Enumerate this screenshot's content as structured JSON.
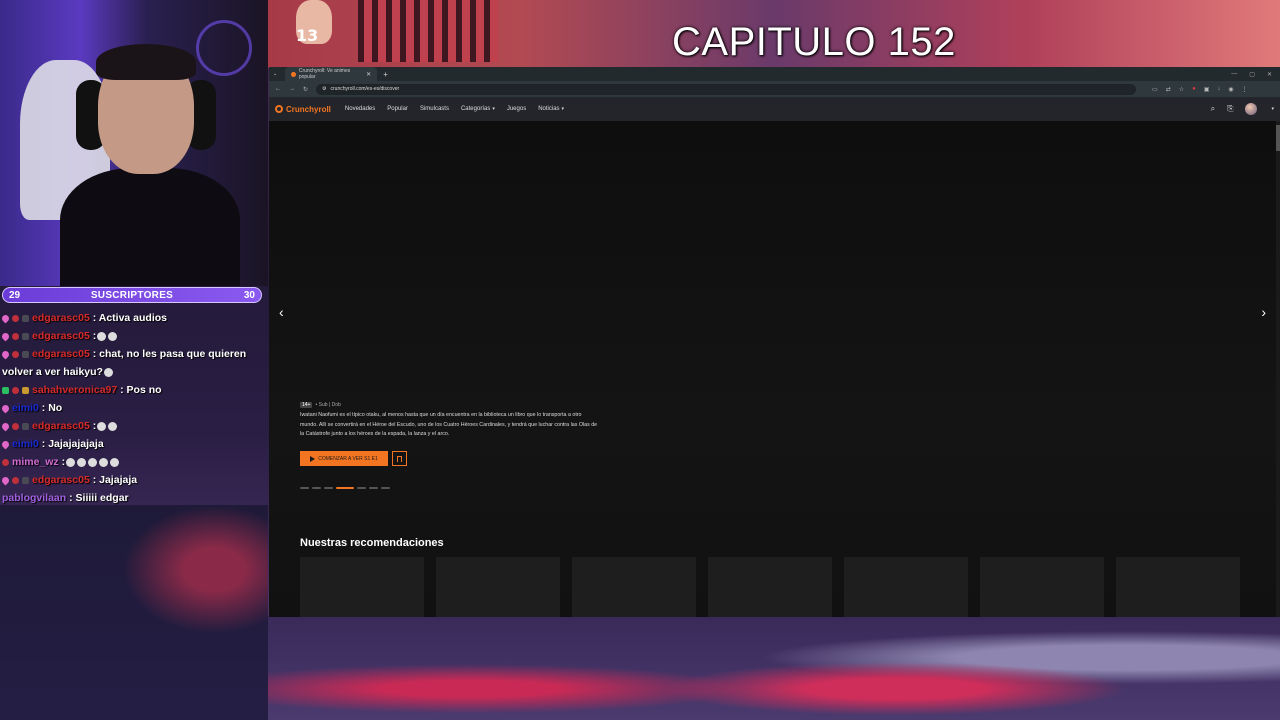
{
  "overlay": {
    "title": "CAPITULO 152",
    "viewer_badge": "13"
  },
  "subs_bar": {
    "left_count": "29",
    "label": "SUSCRIPTORES",
    "right_count": "30"
  },
  "chat": [
    {
      "user": "edgarasc05",
      "message": ": Activa audios",
      "user_color": "#d42a2a",
      "badges": [
        "heart",
        "red",
        "dark"
      ],
      "emotes": 0
    },
    {
      "user": "edgarasc05",
      "message": ":",
      "user_color": "#d42a2a",
      "badges": [
        "heart",
        "red",
        "dark"
      ],
      "emotes": 2
    },
    {
      "user": "edgarasc05",
      "message": ": chat, no les pasa que quieren volver a ver haikyu?",
      "user_color": "#d42a2a",
      "badges": [
        "heart",
        "red",
        "dark"
      ],
      "emotes": 1
    },
    {
      "user": "sahahveronica97",
      "message": ": Pos no",
      "user_color": "#d42a2a",
      "badges": [
        "green",
        "red",
        "gold"
      ],
      "emotes": 0
    },
    {
      "user": "eimi0",
      "message": ": No",
      "user_color": "#1a2ad0",
      "badges": [
        "heart"
      ],
      "emotes": 0
    },
    {
      "user": "edgarasc05",
      "message": ":",
      "user_color": "#d42a2a",
      "badges": [
        "heart",
        "red",
        "dark"
      ],
      "emotes": 2
    },
    {
      "user": "eimi0",
      "message": ": Jajajajajaja",
      "user_color": "#1a2ad0",
      "badges": [
        "heart"
      ],
      "emotes": 0
    },
    {
      "user": "mime_wz",
      "message": ":",
      "user_color": "#d06ad0",
      "badges": [
        "red"
      ],
      "emotes": 5
    },
    {
      "user": "edgarasc05",
      "message": ": Jajajaja",
      "user_color": "#d42a2a",
      "badges": [
        "heart",
        "red",
        "dark"
      ],
      "emotes": 0
    },
    {
      "user": "pablogvilaan",
      "message": ": Siiiii edgar",
      "user_color": "#a060e0",
      "badges": [],
      "emotes": 0
    }
  ],
  "browser": {
    "tab_title": "Crunchyroll: Ve animes popular",
    "url": "crunchyroll.com/es-es/discover"
  },
  "crunchyroll": {
    "logo": "Crunchyroll",
    "nav": [
      {
        "label": "Novedades",
        "dropdown": false
      },
      {
        "label": "Popular",
        "dropdown": false
      },
      {
        "label": "Simulcasts",
        "dropdown": false
      },
      {
        "label": "Categorías",
        "dropdown": true
      },
      {
        "label": "Juegos",
        "dropdown": false
      },
      {
        "label": "Noticias",
        "dropdown": true
      }
    ],
    "hero": {
      "rating": "14+",
      "audio": "• Sub | Dob",
      "description": "Iwatani Naofumi es el típico otaku, al menos hasta que un día encuentra en la biblioteca un libro que lo transporta a otro mundo. Allí se convertirá en el Héroe del Escudo, uno de los Cuatro Héroes Cardinales, y tendrá que luchar contra las Olas de la Catástrofe junto a los héroes de la espada, la lanza y el arco.",
      "cta_label": "COMENZAR A VER S1 E1",
      "carousel_count": 7,
      "carousel_active": 4
    },
    "recs_title": "Nuestras recomendaciones",
    "rec_card_count": 7
  },
  "colors": {
    "accent": "#f47521",
    "subs_bar": "#6c3cd8"
  }
}
